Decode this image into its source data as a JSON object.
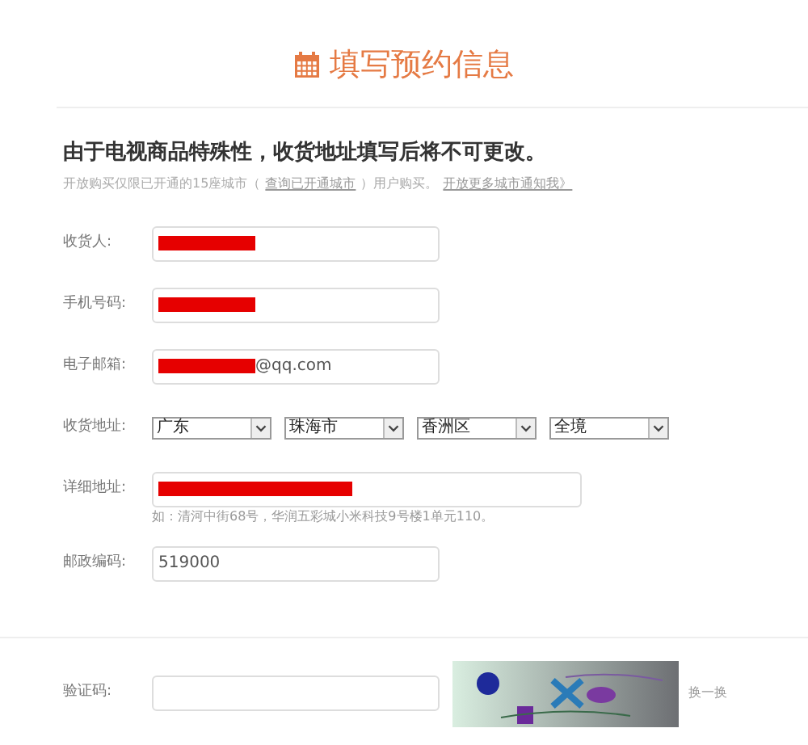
{
  "title": "填写预约信息",
  "notice": {
    "heading": "由于电视商品特殊性，收货地址填写后将不可更改。",
    "parts": [
      {
        "kind": "text",
        "text": "开放购买仅限已开通的15座城市（"
      },
      {
        "kind": "link",
        "text": "查询已开通城市"
      },
      {
        "kind": "text",
        "text": "）用户购买。"
      },
      {
        "kind": "link",
        "text": "开放更多城市通知我》"
      }
    ]
  },
  "fields": [
    {
      "kind": "input",
      "label": "收货人:",
      "redacted": true,
      "wide": false
    },
    {
      "kind": "input",
      "label": "手机号码:",
      "redacted": true,
      "wide": false
    },
    {
      "kind": "input",
      "label": "电子邮箱:",
      "redacted": true,
      "value": "@qq.com",
      "wide": false
    },
    {
      "kind": "selects",
      "label": "收货地址:",
      "options": [
        "广东",
        "珠海市",
        "香洲区",
        "全境"
      ]
    },
    {
      "kind": "input",
      "label": "详细地址:",
      "redacted": true,
      "wide": true,
      "hint": "如：清河中街68号，华润五彩城小米科技9号楼1单元110。"
    },
    {
      "kind": "input",
      "label": "邮政编码:",
      "redacted": false,
      "value": "519000",
      "wide": false
    }
  ],
  "captcha": {
    "label": "验证码:",
    "refresh": "换一换"
  }
}
